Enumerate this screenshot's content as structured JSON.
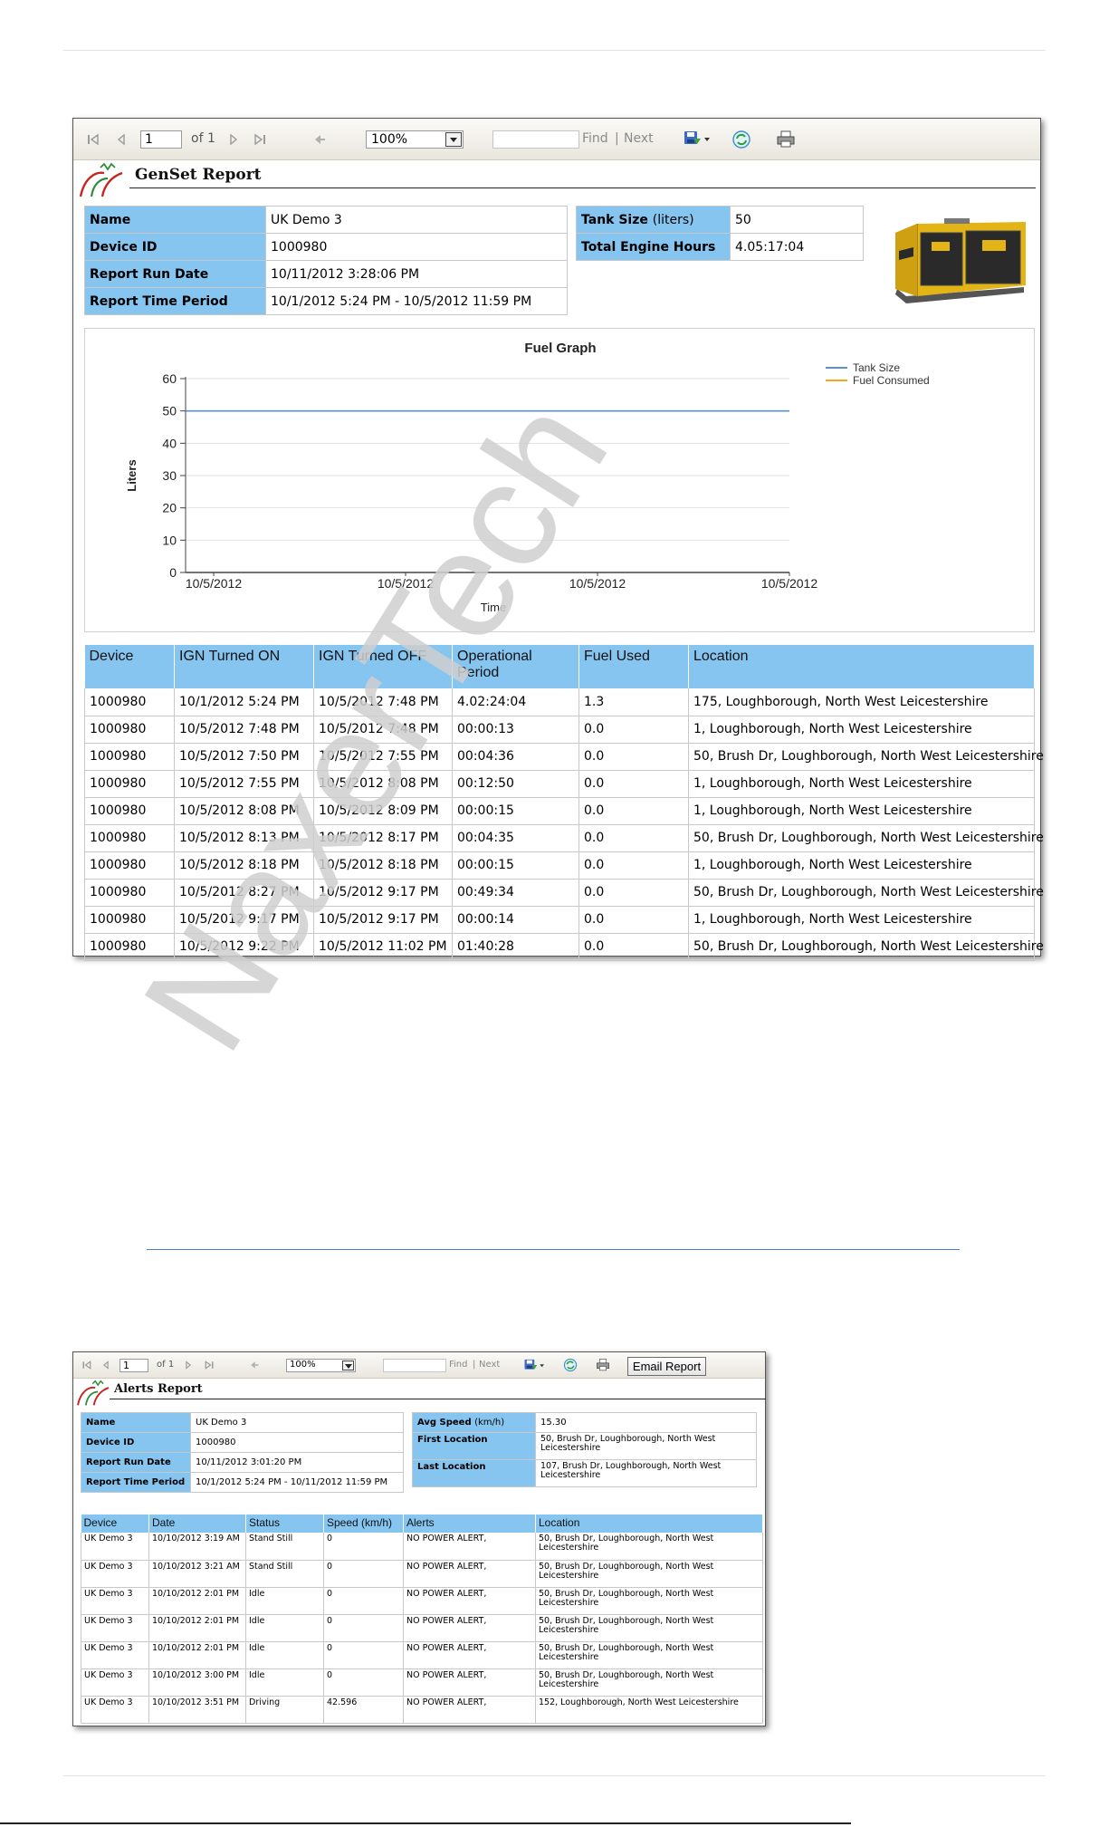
{
  "report1": {
    "toolbar": {
      "page": "1",
      "of_pages": "of 1",
      "zoom": "100%",
      "find": "Find",
      "separator": "|",
      "next": "Next"
    },
    "title": "GenSet Report",
    "info_left": [
      {
        "label": "Name",
        "value": "UK Demo 3"
      },
      {
        "label": "Device ID",
        "value": "1000980"
      },
      {
        "label": "Report Run Date",
        "value": "10/11/2012 3:28:06 PM"
      },
      {
        "label": "Report Time Period",
        "value": "10/1/2012 5:24 PM - 10/5/2012 11:59 PM"
      }
    ],
    "info_right": [
      {
        "label": "Tank Size",
        "label_suffix": "(liters)",
        "value": "50"
      },
      {
        "label": "Total Engine Hours",
        "label_suffix": "",
        "value": "4.05:17:04"
      }
    ],
    "table": {
      "headers": [
        "Device",
        "IGN Turned ON",
        "IGN Turned OFF",
        "Operational Period",
        "Fuel Used",
        "Location"
      ],
      "rows": [
        [
          "1000980",
          "10/1/2012 5:24 PM",
          "10/5/2012 7:48 PM",
          "4.02:24:04",
          "1.3",
          "175, Loughborough, North West Leicestershire"
        ],
        [
          "1000980",
          "10/5/2012 7:48 PM",
          "10/5/2012 7:48 PM",
          "00:00:13",
          "0.0",
          "1, Loughborough, North West Leicestershire"
        ],
        [
          "1000980",
          "10/5/2012 7:50 PM",
          "10/5/2012 7:55 PM",
          "00:04:36",
          "0.0",
          "50, Brush Dr, Loughborough, North West Leicestershire"
        ],
        [
          "1000980",
          "10/5/2012 7:55 PM",
          "10/5/2012 8:08 PM",
          "00:12:50",
          "0.0",
          "1, Loughborough, North West Leicestershire"
        ],
        [
          "1000980",
          "10/5/2012 8:08 PM",
          "10/5/2012 8:09 PM",
          "00:00:15",
          "0.0",
          "1, Loughborough, North West Leicestershire"
        ],
        [
          "1000980",
          "10/5/2012 8:13 PM",
          "10/5/2012 8:17 PM",
          "00:04:35",
          "0.0",
          "50, Brush Dr, Loughborough, North West Leicestershire"
        ],
        [
          "1000980",
          "10/5/2012 8:18 PM",
          "10/5/2012 8:18 PM",
          "00:00:15",
          "0.0",
          "1, Loughborough, North West Leicestershire"
        ],
        [
          "1000980",
          "10/5/2012 8:27 PM",
          "10/5/2012 9:17 PM",
          "00:49:34",
          "0.0",
          "50, Brush Dr, Loughborough, North West Leicestershire"
        ],
        [
          "1000980",
          "10/5/2012 9:17 PM",
          "10/5/2012 9:17 PM",
          "00:00:14",
          "0.0",
          "1, Loughborough, North West Leicestershire"
        ],
        [
          "1000980",
          "10/5/2012 9:22 PM",
          "10/5/2012 11:02 PM",
          "01:40:28",
          "0.0",
          "50, Brush Dr, Loughborough, North West Leicestershire"
        ]
      ]
    }
  },
  "chart_data": {
    "type": "line",
    "title": "Fuel Graph",
    "xlabel": "Time",
    "ylabel": "Liters",
    "x_tick_labels": [
      "10/5/2012",
      "10/5/2012",
      "10/5/2012",
      "10/5/2012"
    ],
    "y_ticks": [
      0,
      10,
      20,
      30,
      40,
      50,
      60
    ],
    "ylim": [
      0,
      60
    ],
    "grid": true,
    "legend_position": "top-right",
    "series": [
      {
        "name": "Tank Size",
        "color": "#5b8fd6",
        "values": [
          50,
          50,
          50,
          50
        ]
      },
      {
        "name": "Fuel Consumed",
        "color": "#f2a81f",
        "values": []
      }
    ]
  },
  "watermark": "NaxerTech",
  "report2": {
    "toolbar": {
      "page": "1",
      "of_pages": "of 1",
      "zoom": "100%",
      "find": "Find",
      "separator": "|",
      "next": "Next",
      "email_button": "Email Report"
    },
    "title": "Alerts Report",
    "info_left": [
      {
        "label": "Name",
        "value": "UK Demo 3"
      },
      {
        "label": "Device ID",
        "value": "1000980"
      },
      {
        "label": "Report Run Date",
        "value": "10/11/2012 3:01:20 PM"
      },
      {
        "label": "Report Time Period",
        "value": "10/1/2012 5:24 PM - 10/11/2012 11:59 PM"
      }
    ],
    "info_right": [
      {
        "label": "Avg Speed",
        "label_suffix": "(km/h)",
        "value": "15.30"
      },
      {
        "label": "First Location",
        "label_suffix": "",
        "value": "50, Brush Dr, Loughborough, North West Leicestershire"
      },
      {
        "label": "Last Location",
        "label_suffix": "",
        "value": "107, Brush Dr, Loughborough, North West Leicestershire"
      }
    ],
    "table": {
      "headers": [
        "Device",
        "Date",
        "Status",
        "Speed (km/h)",
        "Alerts",
        "Location"
      ],
      "rows": [
        [
          "UK Demo 3",
          "10/10/2012 3:19 AM",
          "Stand Still",
          "0",
          "NO POWER ALERT,",
          "50, Brush Dr, Loughborough, North West Leicestershire"
        ],
        [
          "UK Demo 3",
          "10/10/2012 3:21 AM",
          "Stand Still",
          "0",
          "NO POWER ALERT,",
          "50, Brush Dr, Loughborough, North West Leicestershire"
        ],
        [
          "UK Demo 3",
          "10/10/2012 2:01 PM",
          "Idle",
          "0",
          "NO POWER ALERT,",
          "50, Brush Dr, Loughborough, North West Leicestershire"
        ],
        [
          "UK Demo 3",
          "10/10/2012 2:01 PM",
          "Idle",
          "0",
          "NO POWER ALERT,",
          "50, Brush Dr, Loughborough, North West Leicestershire"
        ],
        [
          "UK Demo 3",
          "10/10/2012 2:01 PM",
          "Idle",
          "0",
          "NO POWER ALERT,",
          "50, Brush Dr, Loughborough, North West Leicestershire"
        ],
        [
          "UK Demo 3",
          "10/10/2012 3:00 PM",
          "Idle",
          "0",
          "NO POWER ALERT,",
          "50, Brush Dr, Loughborough, North West Leicestershire"
        ],
        [
          "UK Demo 3",
          "10/10/2012 3:51 PM",
          "Driving",
          "42.596",
          "NO POWER ALERT,",
          "152, Loughborough, North West Leicestershire"
        ]
      ]
    }
  }
}
